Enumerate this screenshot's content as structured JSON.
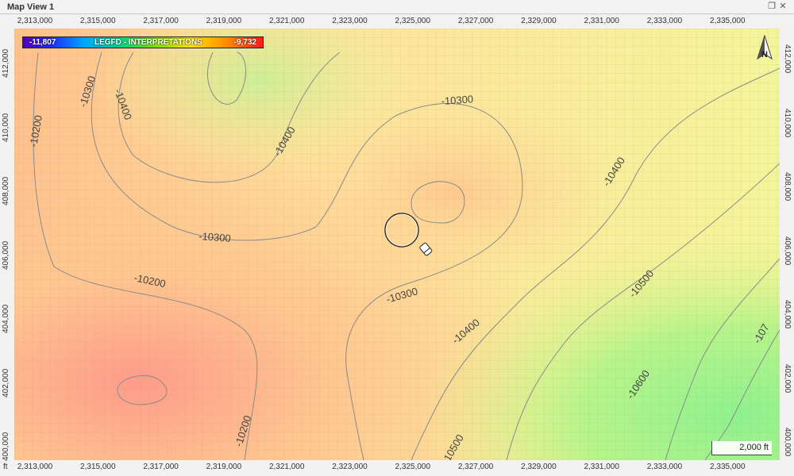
{
  "window": {
    "title": "Map View 1"
  },
  "axes": {
    "x_labels": [
      "2,313,000",
      "2,315,000",
      "2,317,000",
      "2,319,000",
      "2,321,000",
      "2,323,000",
      "2,325,000",
      "2,327,000",
      "2,329,000",
      "2,331,000",
      "2,333,000",
      "2,335,000"
    ],
    "y_labels": [
      "412,000",
      "410,000",
      "408,000",
      "406,000",
      "404,000",
      "402,000",
      "400,000"
    ],
    "unit": "ft"
  },
  "legend": {
    "min": "-11,807",
    "title": "LEGFD - INTERPRETATIONS",
    "max": "-9,732"
  },
  "contours": {
    "labels": [
      "-10300",
      "-10400",
      "-10200",
      "-10400",
      "-10300",
      "-10300",
      "-10200",
      "-10300",
      "-10400",
      "-10400",
      "-10500",
      "-10600",
      "-10200",
      "-10500",
      "-107"
    ]
  },
  "scalebar": {
    "label": "2,000 ft"
  },
  "north_arrow": {
    "label": "N"
  },
  "colors": {
    "high": "#ff8f7a",
    "mid": "#fff29a",
    "low": "#8ff08f"
  }
}
